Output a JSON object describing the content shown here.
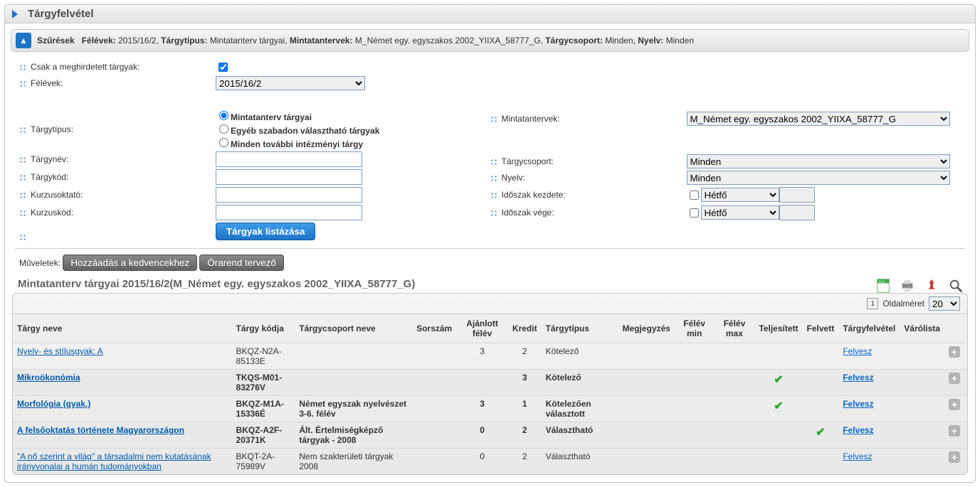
{
  "header": {
    "title": "Tárgyfelvétel"
  },
  "filterbar": {
    "label": "Szűrések",
    "summary": {
      "k1": "Félévek:",
      "v1": "2015/16/2",
      "k2": "Tárgytípus:",
      "v2": "Mintatanterv tárgyai",
      "k3": "Mintatantervek:",
      "v3": "M_Német egy. egyszakos 2002_YIIXA_58777_G",
      "k4": "Tárgycsoport:",
      "v4": "Minden",
      "k5": "Nyelv:",
      "v5": "Minden"
    }
  },
  "labels": {
    "only_announced": "Csak a meghirdetett tárgyak:",
    "semesters": "Félévek:",
    "subj_type": "Tárgytípus:",
    "r1": "Mintatanterv tárgyai",
    "r2": "Egyéb szabadon választható tárgyak",
    "r3": "Minden további intézményi tárgy",
    "subj_name": "Tárgynév:",
    "subj_code": "Tárgykód:",
    "teacher": "Kurzusoktató:",
    "course_code": "Kurzuskód:",
    "curricula": "Mintatantervek:",
    "group": "Tárgycsoport:",
    "lang": "Nyelv:",
    "period_start": "Időszak kezdete:",
    "period_end": "Időszak vége:",
    "list_btn": "Tárgyak listázása",
    "ops": "Műveletek:",
    "fav": "Hozzáadás a kedvencekhez",
    "planner": "Órarend tervező"
  },
  "selects": {
    "semester": "2015/16/2",
    "curriculum": "M_Német egy. egyszakos 2002_YIIXA_58777_G",
    "group": "Minden",
    "lang": "Minden",
    "day1": "Hétfő",
    "day2": "Hétfő"
  },
  "list": {
    "title": "Mintatanterv tárgyai 2015/16/2(M_Német egy. egyszakos 2002_YIIXA_58777_G)",
    "pagesize_label": "Oldalméret",
    "pagesize": "20",
    "page": "1"
  },
  "cols": {
    "name": "Tárgy neve",
    "code": "Tárgy kódja",
    "group": "Tárgycsoport neve",
    "order": "Sorszám",
    "rec": "Ajánlott félév",
    "credit": "Kredit",
    "type": "Tárgytípus",
    "note": "Megjegyzés",
    "min": "Félév min",
    "max": "Félév max",
    "done": "Teljesített",
    "taken": "Felvett",
    "reg": "Tárgyfelvétel",
    "wait": "Várólista"
  },
  "rows": [
    {
      "name": "Nyelv- és stílusgyak: A",
      "code": "BKQZ-N2A-85133E",
      "group": "",
      "order": "",
      "rec": "3",
      "credit": "2",
      "type": "Kötelező",
      "done": false,
      "taken": false,
      "reg": "Felvesz"
    },
    {
      "name": "Mikroökonómia",
      "code": "TKQS-M01-83276V",
      "group": "",
      "order": "",
      "rec": "",
      "credit": "3",
      "type": "Kötelező",
      "done": true,
      "taken": false,
      "reg": "Felvesz"
    },
    {
      "name": "Morfológia (gyak.)",
      "code": "BKQZ-M1A-15336É",
      "group": "Német egyszak nyelvészet 3-6. félév",
      "order": "",
      "rec": "3",
      "credit": "1",
      "type": "Kötelezően választott",
      "done": true,
      "taken": false,
      "reg": "Felvesz"
    },
    {
      "name": "A felsőoktatás története Magyarországon",
      "code": "BKQZ-A2F-20371K",
      "group": "Ált. Értelmiségképző tárgyak - 2008",
      "order": "",
      "rec": "0",
      "credit": "2",
      "type": "Választható",
      "done": false,
      "taken": true,
      "reg": "Felvesz"
    },
    {
      "name": "\"A nő szerint a világ\" a társadalmi nem kutatásának irányvonalai a humán tudományokban",
      "code": "BKQT-2A-75989V",
      "group": "Nem szakterületi tárgyak 2008",
      "order": "",
      "rec": "0",
      "credit": "2",
      "type": "Választható",
      "done": false,
      "taken": false,
      "reg": "Felvesz"
    }
  ],
  "chart_data": {
    "type": "table"
  }
}
